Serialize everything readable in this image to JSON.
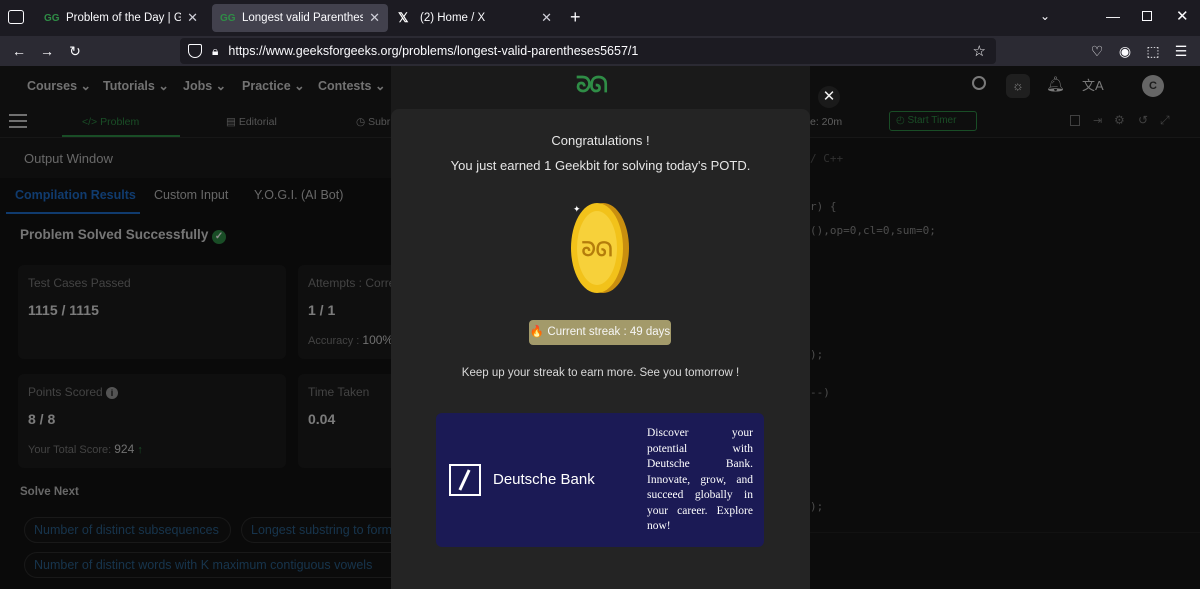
{
  "browser": {
    "tabs": [
      {
        "favicon": "gfg-icon",
        "title": "Problem of the Day | GeeksforG"
      },
      {
        "favicon": "gfg-icon",
        "title": "Longest valid Parentheses | Prac"
      },
      {
        "favicon": "x-icon",
        "title": "(2) Home / X"
      }
    ],
    "url": "https://www.geeksforgeeks.org/problems/longest-valid-parentheses5657/1"
  },
  "gfg": {
    "nav": [
      "Courses",
      "Tutorials",
      "Jobs",
      "Practice",
      "Contests"
    ],
    "avatar_letter": "C",
    "subtabs": {
      "problem": "Problem",
      "editorial": "Editorial",
      "submissions": "Subr"
    },
    "timer_label": "e: 20m",
    "start_timer": "Start Timer"
  },
  "left": {
    "output_window": "Output Window",
    "tabs": [
      "Compilation Results",
      "Custom Input",
      "Y.O.G.I. (AI Bot)"
    ],
    "status": "Problem Solved Successfully",
    "test_cases_label": "Test Cases Passed",
    "test_cases_value": "1115 / 1115",
    "attempts_label": "Attempts : Corre",
    "attempts_value": "1 / 1",
    "accuracy_label": "Accuracy : ",
    "accuracy_value": "100%",
    "points_label": "Points Scored",
    "points_value": "8 / 8",
    "total_score_label": "Your Total Score: ",
    "total_score_value": "924",
    "time_label": "Time Taken",
    "time_value": "0.04",
    "solve_next": "Solve Next",
    "suggestions": [
      "Number of distinct subsequences",
      "Longest substring to form",
      "Number of distinct words with K maximum contiguous vowels"
    ]
  },
  "code_lines": [
    "/ C++",
    "r) {",
    "(),op=0,cl=0,sum=0;",
    ");",
    "--)",
    ");"
  ],
  "modal": {
    "title": "Congratulations !",
    "subtitle": "You just earned 1 Geekbit for solving today's POTD.",
    "streak": "🔥 Current streak : 49 days",
    "message": "Keep up your streak to earn more. See you tomorrow !",
    "ad_brand": "Deutsche Bank",
    "ad_text": "Discover your potential with Deutsche Bank. Innovate, grow, and succeed globally in your career. Explore now!"
  },
  "colors": {
    "gfg_green": "#2f8d46",
    "accent_blue": "#1e6cc8",
    "streak_bg": "#a39a6a",
    "ad_bg": "#1b1a55",
    "coin": "#f2c21a"
  }
}
